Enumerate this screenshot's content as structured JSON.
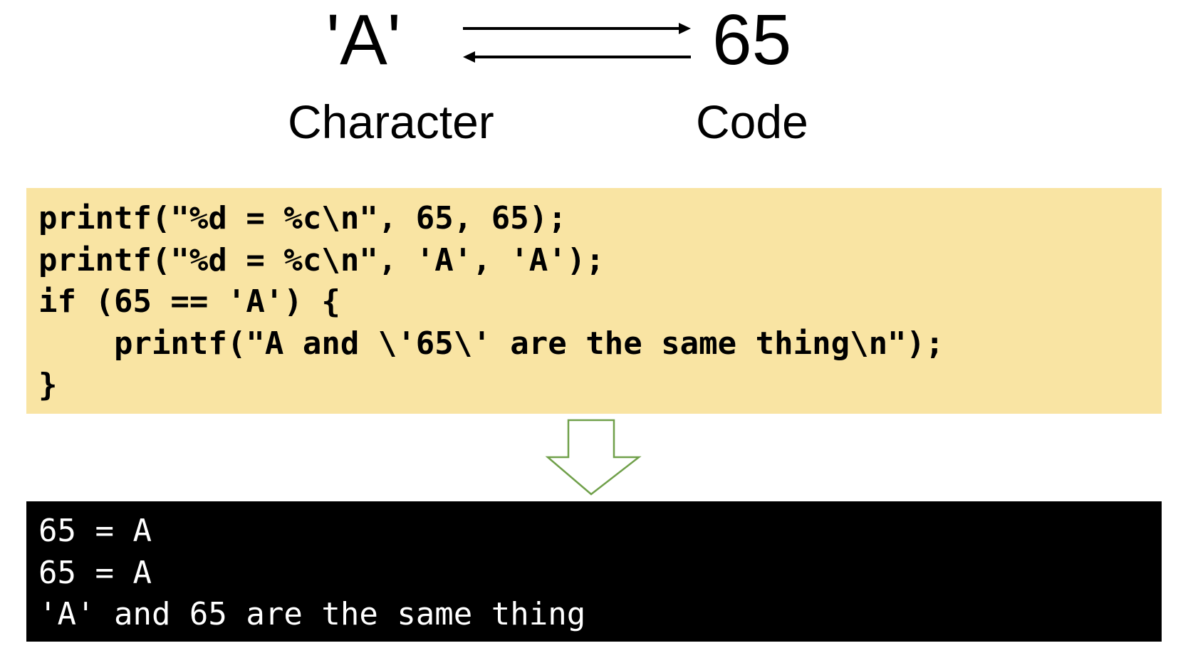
{
  "mapping": {
    "character_value": "'A'",
    "code_value": "65",
    "character_label": "Character",
    "code_label": "Code"
  },
  "code_block": {
    "background_color": "#f9e4a3",
    "lines": [
      "printf(\"%d = %c\\n\", 65, 65);",
      "printf(\"%d = %c\\n\", 'A', 'A');",
      "if (65 == 'A') {",
      "    printf(\"A and \\'65\\' are the same thing\\n\");",
      "}"
    ]
  },
  "output_block": {
    "background_color": "#000000",
    "text_color": "#ffffff",
    "lines": [
      "65 = A",
      "65 = A",
      "'A' and 65 are the same thing"
    ]
  },
  "down_arrow_color": "#70a04a"
}
